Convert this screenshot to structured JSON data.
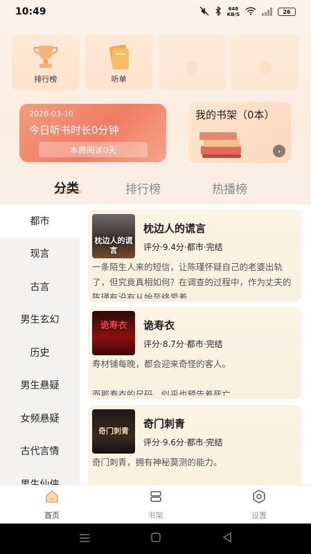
{
  "status_bar": {
    "time": "10:49",
    "net_speed_value": "648",
    "net_speed_unit": "KB/S",
    "battery": "26"
  },
  "quick_tiles": [
    {
      "label": "排行榜",
      "icon": "trophy-icon"
    },
    {
      "label": "听单",
      "icon": "folder-icon"
    },
    {
      "label": "",
      "icon": "placeholder-icon"
    },
    {
      "label": "",
      "icon": "placeholder-icon"
    }
  ],
  "listen_card": {
    "date": "2026-03-10",
    "title": "今日听书时长0分钟",
    "week_button": "本周阅读0天"
  },
  "bookshelf_card": {
    "title": "我的书架（0本）",
    "arrow": "›"
  },
  "main_tabs": [
    {
      "label": "分类",
      "active": true
    },
    {
      "label": "排行榜",
      "active": false
    },
    {
      "label": "热播榜",
      "active": false
    }
  ],
  "categories": [
    {
      "label": "都市",
      "active": true
    },
    {
      "label": "现言",
      "active": false
    },
    {
      "label": "古言",
      "active": false
    },
    {
      "label": "男生玄幻",
      "active": false
    },
    {
      "label": "历史",
      "active": false
    },
    {
      "label": "男生悬疑",
      "active": false
    },
    {
      "label": "女频悬疑",
      "active": false
    },
    {
      "label": "古代言情",
      "active": false
    },
    {
      "label": "男生仙侠",
      "active": false
    }
  ],
  "books": [
    {
      "title": "枕边人的谎言",
      "meta": "评分·9.4分·都市·完结",
      "cover_text": "枕边人的谎言",
      "desc": "一条陌生人来的短信，让陈瑾怀疑自己的老婆出轨了，但究竟真相如何？在调查的过程中，作为丈夫的陈瑾有没有从始至终爱着..."
    },
    {
      "title": "诡寿衣",
      "meta": "评分·8.7分·都市·完结",
      "cover_text": "诡寿衣",
      "desc": "寿材铺每晚，都会迎来奇怪的客人。\n\n而那寿衣的尺码，似乎也预告着死亡。"
    },
    {
      "title": "奇门刺青",
      "meta": "评分·9.6分·都市·完结",
      "cover_text": "奇门刺青",
      "desc": "奇门刺青，拥有神秘莫测的能力。\n\n一个少年，在摩练和探险之中，一步..."
    }
  ],
  "bottom_nav": [
    {
      "label": "首页",
      "icon": "home-icon",
      "active": true
    },
    {
      "label": "书架",
      "icon": "bookshelf-icon",
      "active": false
    },
    {
      "label": "设置",
      "icon": "settings-icon",
      "active": false
    }
  ],
  "colors": {
    "accent_orange": "#f07c62",
    "tile_bg": "#fde9d6",
    "card_bg": "#fbf4e4"
  }
}
